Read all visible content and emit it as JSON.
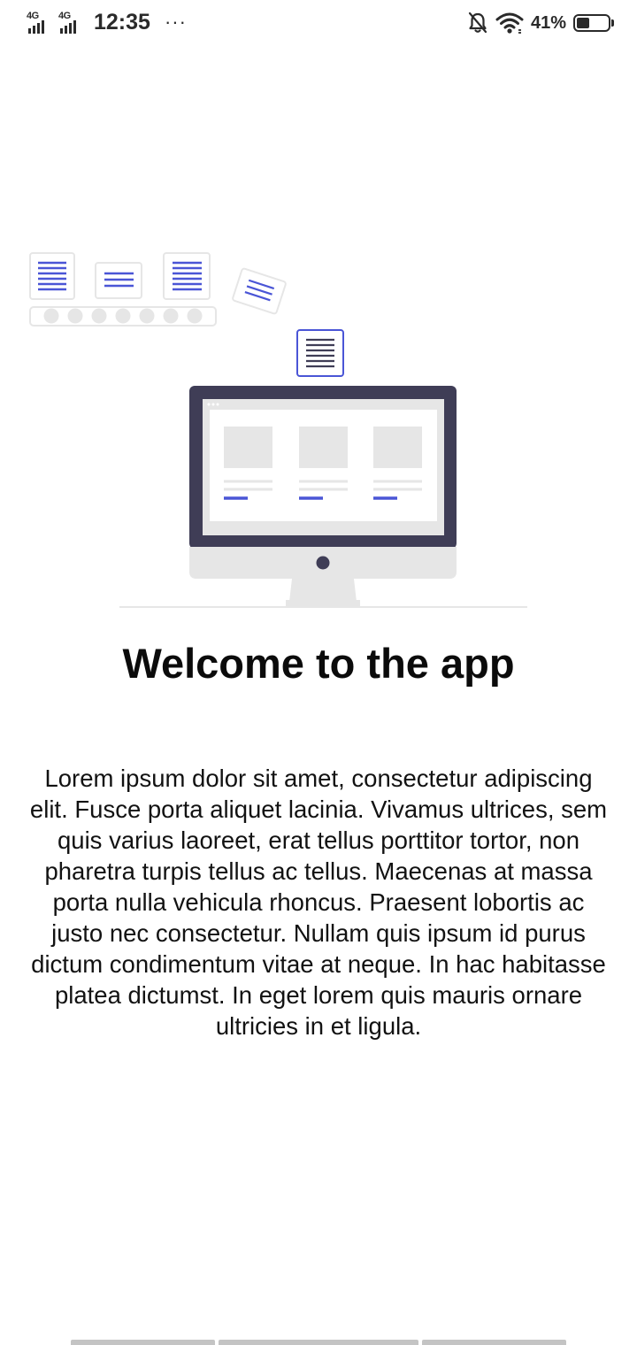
{
  "status_bar": {
    "network_1": "4G",
    "network_2": "4G",
    "time": "12:35",
    "more": "···",
    "battery_percent": "41%",
    "battery_level": 0.41,
    "icons": [
      "signal-icon",
      "signal-icon",
      "mute-bell-icon",
      "wifi-icon",
      "battery-icon"
    ]
  },
  "onboarding": {
    "illustration": "computer-with-documents-illustration",
    "title": "Welcome to the app",
    "body": "Lorem ipsum dolor sit amet, consectetur adipiscing elit. Fusce porta aliquet lacinia. Vivamus ultrices, sem quis varius laoreet, erat tellus porttitor tortor, non pharetra turpis tellus ac tellus. Maecenas at massa porta nulla vehicula rhoncus. Praesent lobortis ac justo nec consectetur. Nullam quis ipsum id purus dictum condimentum vitae at neque. In hac habitasse platea dictumst. In eget lorem quis mauris ornare ultricies in et ligula."
  },
  "page_indicator": {
    "pages": 3,
    "current": 1
  },
  "colors": {
    "accent": "#4a55d6",
    "monitor_frame": "#3f3d56",
    "light_gray": "#e6e6e6",
    "text": "#111111"
  }
}
